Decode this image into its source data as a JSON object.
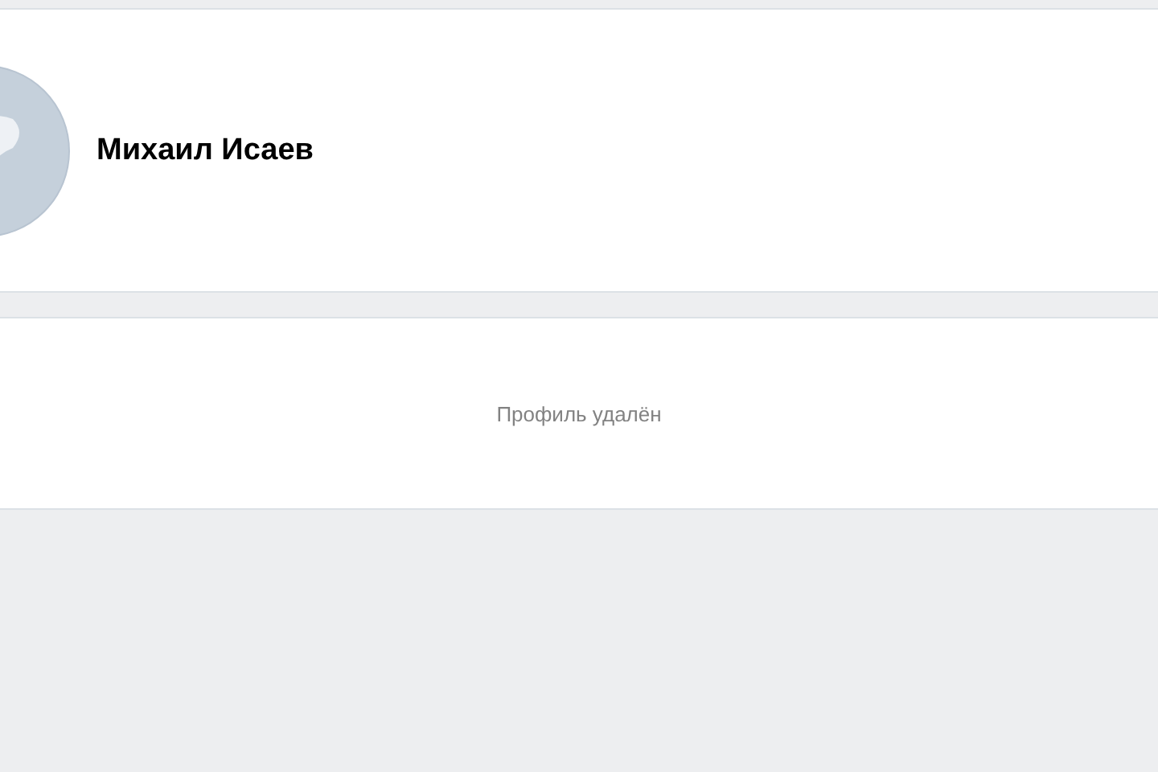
{
  "profile": {
    "name": "Михаил Исаев"
  },
  "notice": {
    "text": "Профиль удалён"
  }
}
